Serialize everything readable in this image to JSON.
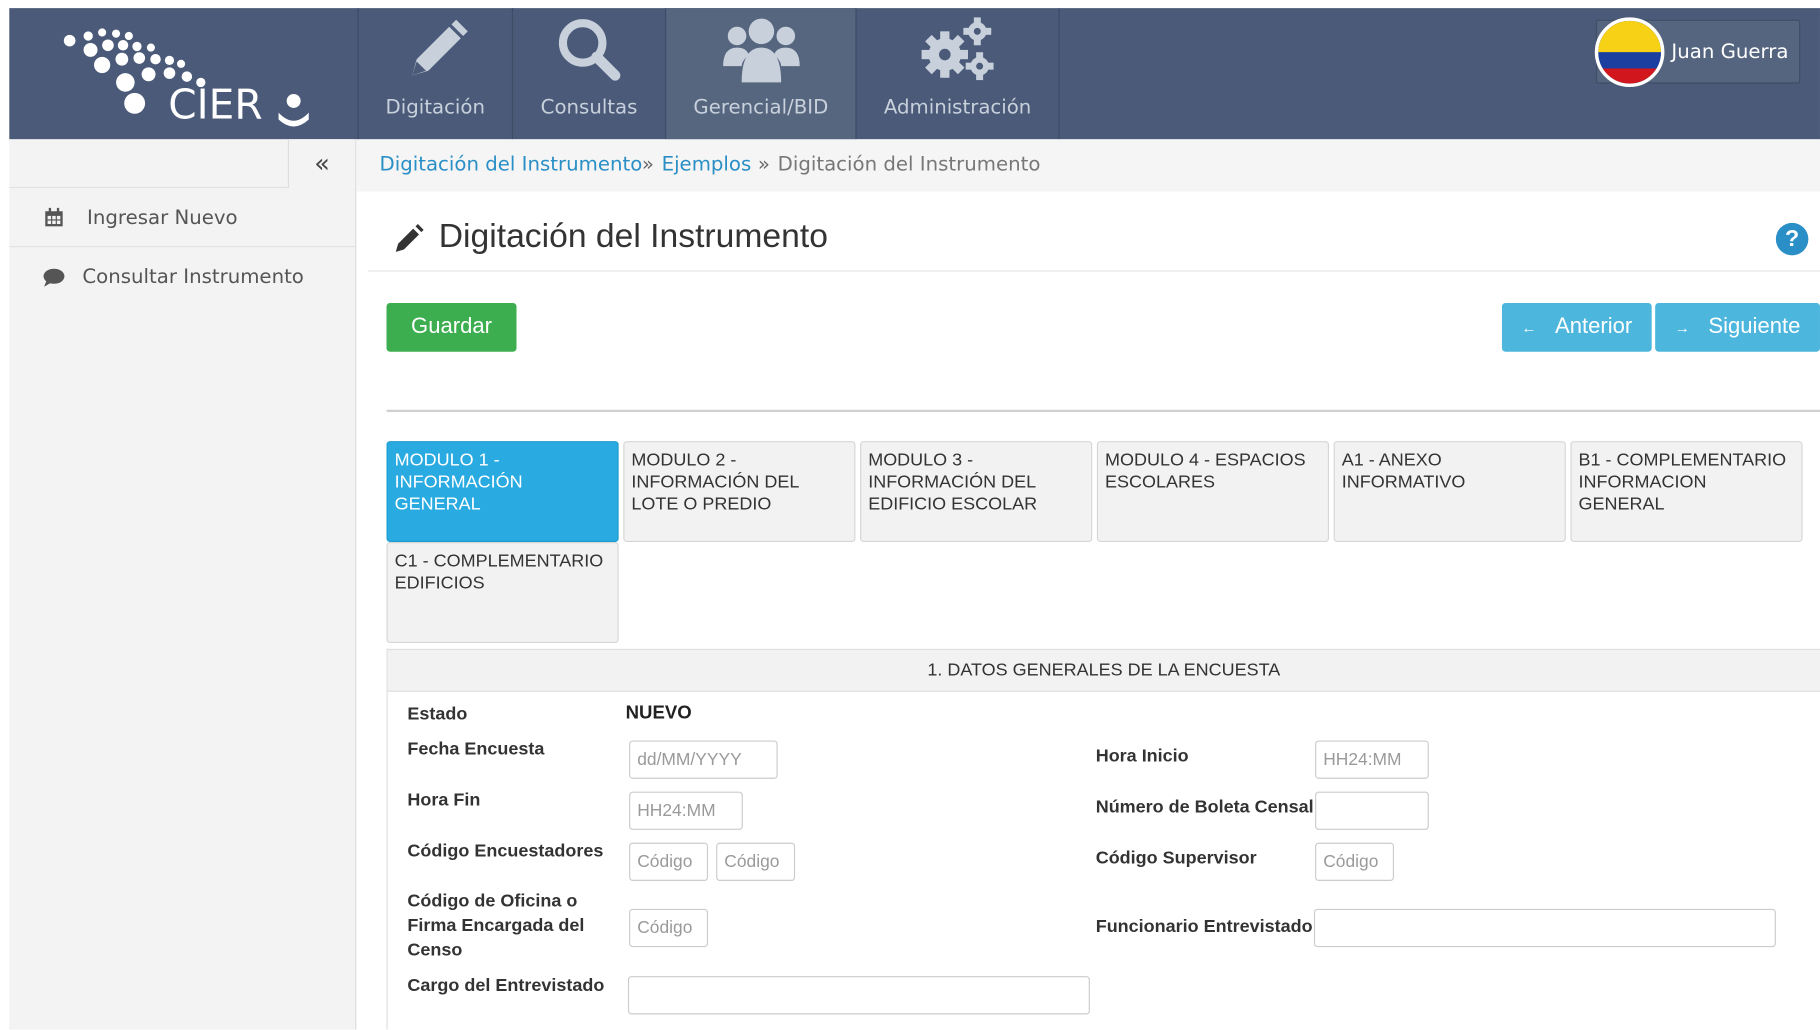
{
  "header": {
    "logo_text": "CIER",
    "nav": [
      {
        "label": "Digitación",
        "icon": "pencil-icon"
      },
      {
        "label": "Consultas",
        "icon": "search-icon"
      },
      {
        "label": "Gerencial/BID",
        "icon": "users-icon"
      },
      {
        "label": "Administración",
        "icon": "gears-icon"
      }
    ],
    "user_name": "Juan Guerra",
    "user_avatar": "colombia-flag-avatar"
  },
  "sidebar": {
    "collapse_label": "«",
    "items": [
      {
        "label": "Ingresar Nuevo",
        "icon": "calendar-icon"
      },
      {
        "label": "Consultar Instrumento",
        "icon": "comment-icon"
      }
    ]
  },
  "breadcrumb": {
    "items": [
      "Digitación del Instrumento",
      "Ejemplos",
      "Digitación del Instrumento"
    ],
    "separator": "»"
  },
  "page": {
    "title": "Digitación del Instrumento",
    "help_label": "?"
  },
  "actions": {
    "save": "Guardar",
    "previous": "Anterior",
    "next": "Siguiente",
    "previous_arrow": "←",
    "next_arrow": "→"
  },
  "tabs": [
    "MODULO 1 - INFORMACIÓN GENERAL",
    "MODULO 2 - INFORMACIÓN DEL LOTE O PREDIO",
    "MODULO 3 - INFORMACIÓN DEL EDIFICIO ESCOLAR",
    "MODULO 4 - ESPACIOS ESCOLARES",
    "A1 - ANEXO INFORMATIVO",
    "B1 - COMPLEMENTARIO INFORMACION GENERAL",
    "C1 - COMPLEMENTARIO EDIFICIOS"
  ],
  "section": {
    "title": "1. DATOS GENERALES DE LA ENCUESTA",
    "estado_label": "Estado",
    "estado_value": "NUEVO",
    "fecha_label": "Fecha Encuesta",
    "fecha_placeholder": "dd/MM/YYYY",
    "hora_inicio_label": "Hora Inicio",
    "hora_inicio_placeholder": "HH24:MM",
    "hora_fin_label": "Hora Fin",
    "hora_fin_placeholder": "HH24:MM",
    "boleta_label": "Número de Boleta Censal",
    "encuestadores_label": "Código Encuestadores",
    "codigo_placeholder": "Código",
    "supervisor_label": "Código Supervisor",
    "oficina_label": "Código de Oficina o Firma Encargada del Censo",
    "funcionario_label": "Funcionario Entrevistado",
    "cargo_label": "Cargo del Entrevistado"
  },
  "colors": {
    "topbar": "#4a5a78",
    "save_button": "#3dae4f",
    "nav_buttons": "#4cb6dd",
    "active_tab": "#29abe2",
    "link": "#2a8fc6"
  }
}
